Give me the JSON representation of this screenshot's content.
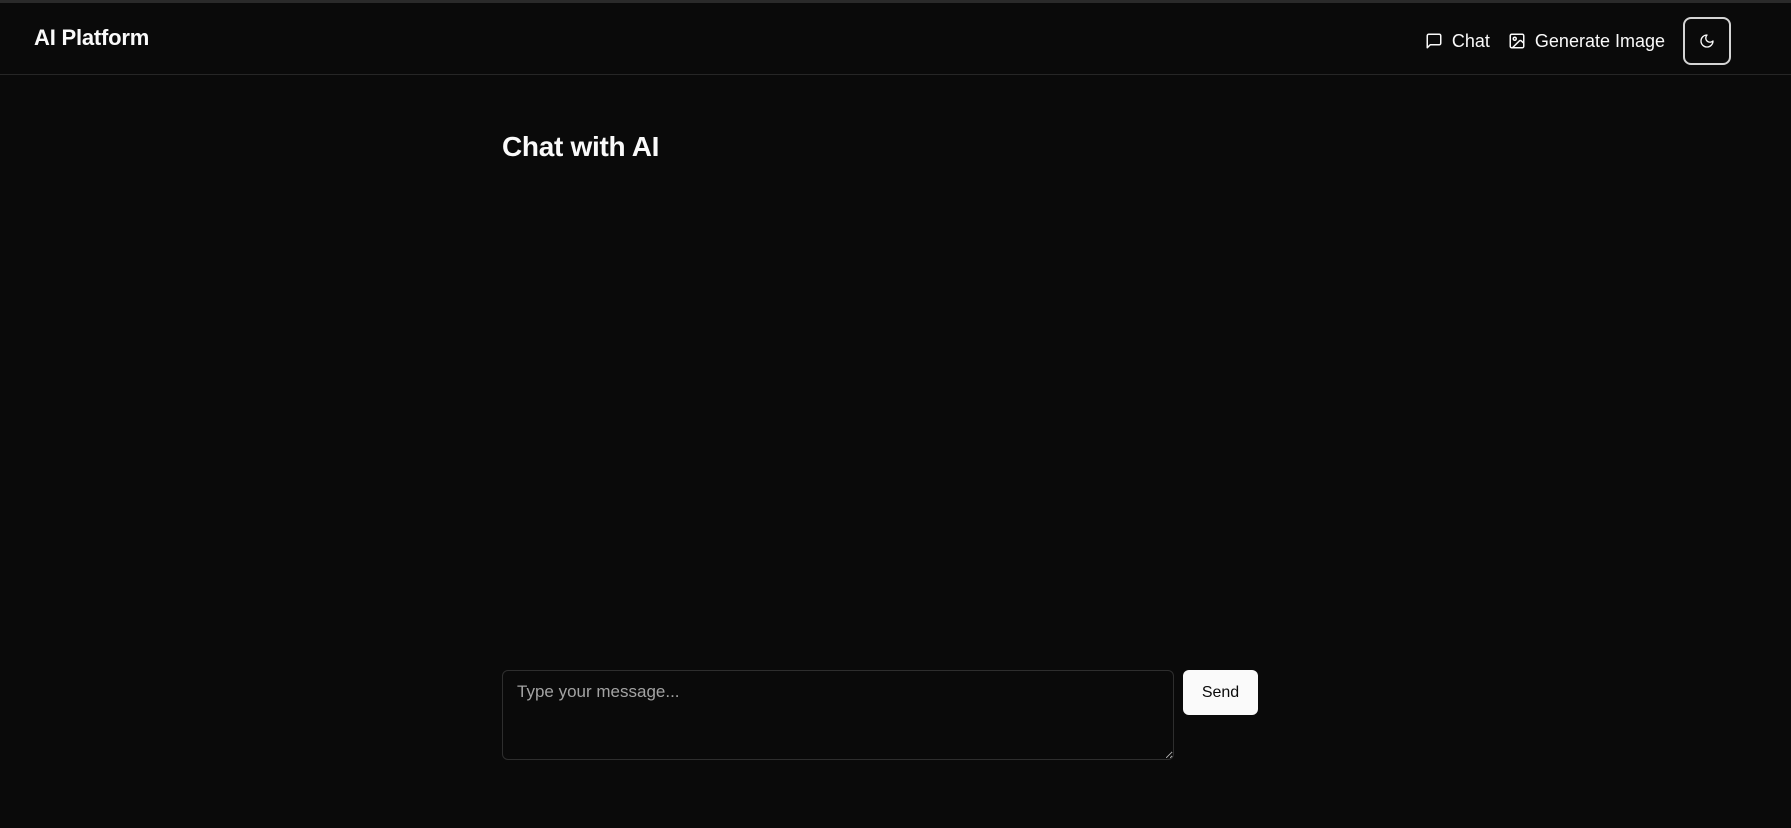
{
  "app": {
    "brand": "AI Platform"
  },
  "header": {
    "nav": [
      {
        "label": "Chat",
        "icon": "message-square-icon"
      },
      {
        "label": "Generate Image",
        "icon": "image-icon"
      }
    ],
    "theme_toggle_icon": "moon-icon"
  },
  "main": {
    "title": "Chat with AI",
    "messages": []
  },
  "composer": {
    "placeholder": "Type your message...",
    "value": "",
    "send_label": "Send"
  },
  "colors": {
    "background": "#0a0a0a",
    "foreground": "#fafafa",
    "border": "#262626",
    "primary_button": "#fafafa",
    "muted_text": "#a3a3a3"
  }
}
